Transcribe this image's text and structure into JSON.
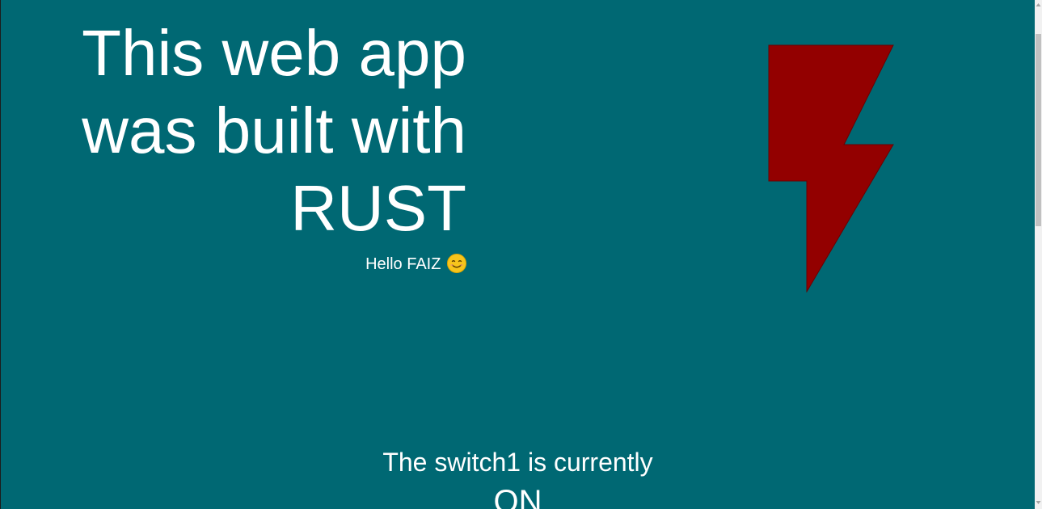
{
  "hero": {
    "title_line1": "This web app",
    "title_line2": "was built with",
    "title_line3": "RUST",
    "greeting": "Hello FAIZ",
    "greeting_emoji": "smiling-face-emoji"
  },
  "logo": {
    "icon": "lightning-bolt-icon",
    "color": "#930000"
  },
  "status": {
    "label": "The switch1 is currently",
    "value": "ON"
  },
  "colors": {
    "background": "#006873",
    "text": "#ffffff"
  }
}
